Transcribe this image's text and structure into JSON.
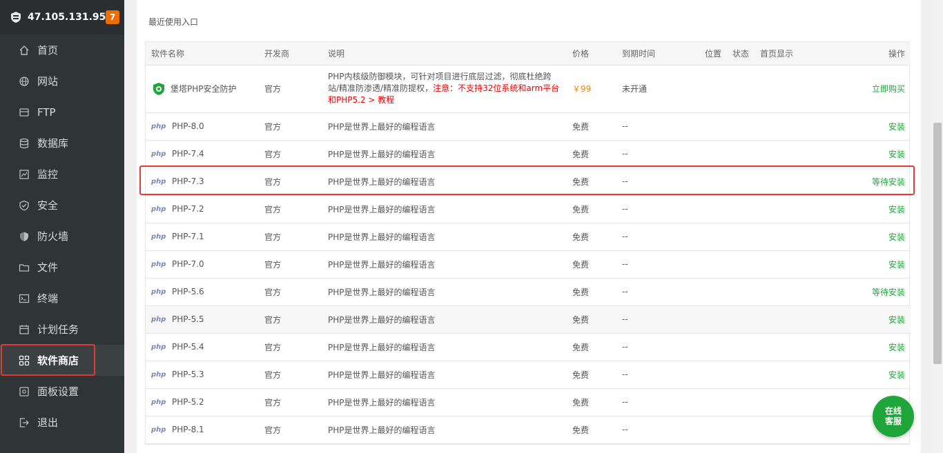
{
  "sidebar": {
    "ip": "47.105.131.95",
    "badge": "7",
    "items": [
      {
        "label": "首页",
        "icon": "home-icon"
      },
      {
        "label": "网站",
        "icon": "globe-icon"
      },
      {
        "label": "FTP",
        "icon": "ftp-icon"
      },
      {
        "label": "数据库",
        "icon": "database-icon"
      },
      {
        "label": "监控",
        "icon": "monitor-icon"
      },
      {
        "label": "安全",
        "icon": "shield-check-icon"
      },
      {
        "label": "防火墙",
        "icon": "firewall-icon"
      },
      {
        "label": "文件",
        "icon": "folder-icon"
      },
      {
        "label": "终端",
        "icon": "terminal-icon"
      },
      {
        "label": "计划任务",
        "icon": "calendar-icon"
      },
      {
        "label": "软件商店",
        "icon": "grid-icon"
      },
      {
        "label": "面板设置",
        "icon": "settings-icon"
      },
      {
        "label": "退出",
        "icon": "logout-icon"
      }
    ]
  },
  "main": {
    "section_title": "最近使用入口",
    "columns": [
      "软件名称",
      "开发商",
      "说明",
      "价格",
      "到期时间",
      "位置",
      "状态",
      "首页显示",
      "操作"
    ],
    "first_row": {
      "name": "堡塔PHP安全防护",
      "developer": "官方",
      "desc_line1": "PHP内核级防御模块，可针对项目进行底层过滤，彻底杜绝跨",
      "desc_line2_prefix": "站/精准防渗透/精准防提权，",
      "desc_warn": "注意：不支持32位系统和arm平台",
      "desc_line3": "和PHP5.2 > 教程",
      "price": "￥99",
      "expire": "未开通",
      "action": "立即购买"
    },
    "rows": [
      {
        "name": "PHP-8.0",
        "developer": "官方",
        "desc": "PHP是世界上最好的编程语言",
        "price": "免费",
        "expire": "--",
        "action": "安装"
      },
      {
        "name": "PHP-7.4",
        "developer": "官方",
        "desc": "PHP是世界上最好的编程语言",
        "price": "免费",
        "expire": "--",
        "action": "安装"
      },
      {
        "name": "PHP-7.3",
        "developer": "官方",
        "desc": "PHP是世界上最好的编程语言",
        "price": "免费",
        "expire": "--",
        "action": "等待安装"
      },
      {
        "name": "PHP-7.2",
        "developer": "官方",
        "desc": "PHP是世界上最好的编程语言",
        "price": "免费",
        "expire": "--",
        "action": "安装"
      },
      {
        "name": "PHP-7.1",
        "developer": "官方",
        "desc": "PHP是世界上最好的编程语言",
        "price": "免费",
        "expire": "--",
        "action": "安装"
      },
      {
        "name": "PHP-7.0",
        "developer": "官方",
        "desc": "PHP是世界上最好的编程语言",
        "price": "免费",
        "expire": "--",
        "action": "安装"
      },
      {
        "name": "PHP-5.6",
        "developer": "官方",
        "desc": "PHP是世界上最好的编程语言",
        "price": "免费",
        "expire": "--",
        "action": "等待安装"
      },
      {
        "name": "PHP-5.5",
        "developer": "官方",
        "desc": "PHP是世界上最好的编程语言",
        "price": "免费",
        "expire": "--",
        "action": "安装"
      },
      {
        "name": "PHP-5.4",
        "developer": "官方",
        "desc": "PHP是世界上最好的编程语言",
        "price": "免费",
        "expire": "--",
        "action": "安装"
      },
      {
        "name": "PHP-5.3",
        "developer": "官方",
        "desc": "PHP是世界上最好的编程语言",
        "price": "免费",
        "expire": "--",
        "action": "安装"
      },
      {
        "name": "PHP-5.2",
        "developer": "官方",
        "desc": "PHP是世界上最好的编程语言",
        "price": "免费",
        "expire": "--",
        "action": ""
      },
      {
        "name": "PHP-8.1",
        "developer": "官方",
        "desc": "PHP是世界上最好的编程语言",
        "price": "免费",
        "expire": "--",
        "action": ""
      }
    ],
    "php_icon_text": "php"
  },
  "chat": {
    "line1": "在线",
    "line2": "客服"
  },
  "colors": {
    "sidebar_bg": "#2f3437",
    "accent_green": "#20a53a",
    "badge_orange": "#ef6c00",
    "highlight_red": "#e53935"
  }
}
